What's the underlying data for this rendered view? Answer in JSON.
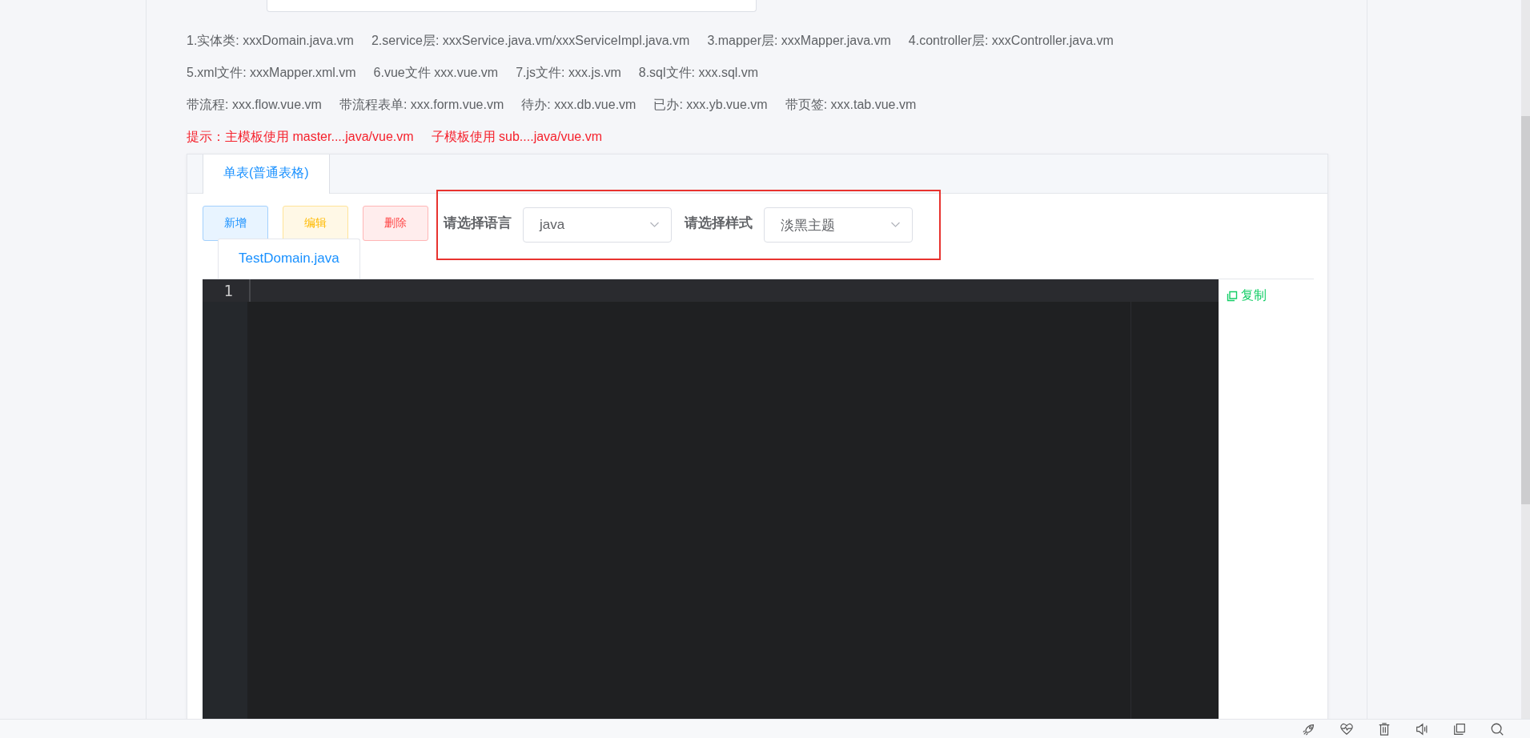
{
  "hint_lines": [
    {
      "kind": "normal",
      "items": [
        "1.实体类: xxxDomain.java.vm",
        "2.service层: xxxService.java.vm/xxxServiceImpl.java.vm",
        "3.mapper层: xxxMapper.java.vm",
        "4.controller层:  xxxController.java.vm"
      ]
    },
    {
      "kind": "normal",
      "items": [
        "5.xml文件: xxxMapper.xml.vm",
        "6.vue文件 xxx.vue.vm",
        "7.js文件: xxx.js.vm",
        "8.sql文件: xxx.sql.vm"
      ]
    },
    {
      "kind": "normal",
      "items": [
        "带流程: xxx.flow.vue.vm",
        "带流程表单: xxx.form.vue.vm",
        "待办: xxx.db.vue.vm",
        "已办: xxx.yb.vue.vm",
        "带页签: xxx.tab.vue.vm"
      ]
    },
    {
      "kind": "warning",
      "items": [
        "提示：主模板使用 master....java/vue.vm",
        "子模板使用 sub....java/vue.vm"
      ]
    }
  ],
  "tabs": [
    {
      "label": "单表(普通表格)",
      "selected": true
    }
  ],
  "buttons": [
    {
      "label": "新增",
      "kind": "primary"
    },
    {
      "label": "编辑",
      "kind": "warning"
    },
    {
      "label": "删除",
      "kind": "danger"
    }
  ],
  "selects": [
    {
      "label": "请选择语言",
      "value": "java"
    },
    {
      "label": "请选择样式",
      "value": "淡黑主题"
    }
  ],
  "file_tabs": [
    {
      "label": "TestDomain.java",
      "selected": true
    }
  ],
  "editor": {
    "line_numbers": [
      "1"
    ]
  },
  "copy_button": {
    "label": "复制"
  }
}
